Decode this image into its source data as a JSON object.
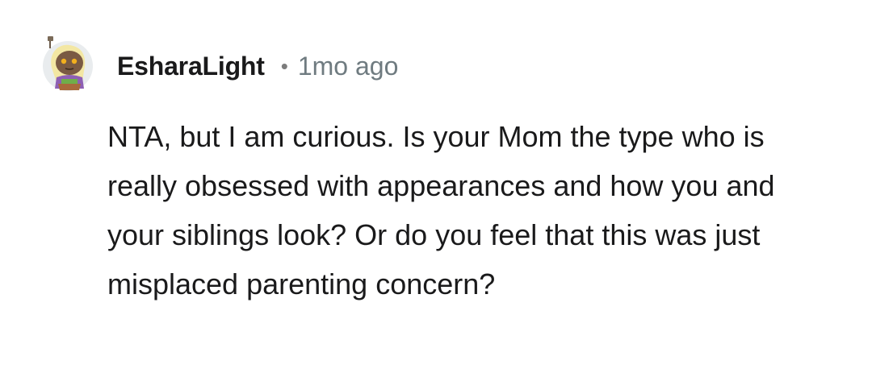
{
  "comment": {
    "avatar_icon": "user-avatar",
    "username": "EsharaLight",
    "separator": "•",
    "age": "1mo ago",
    "text": "NTA, but I am curious. Is your Mom the type who is really obsessed with appearances and how you and your siblings look? Or do you feel that this was just misplaced parenting concern?"
  }
}
